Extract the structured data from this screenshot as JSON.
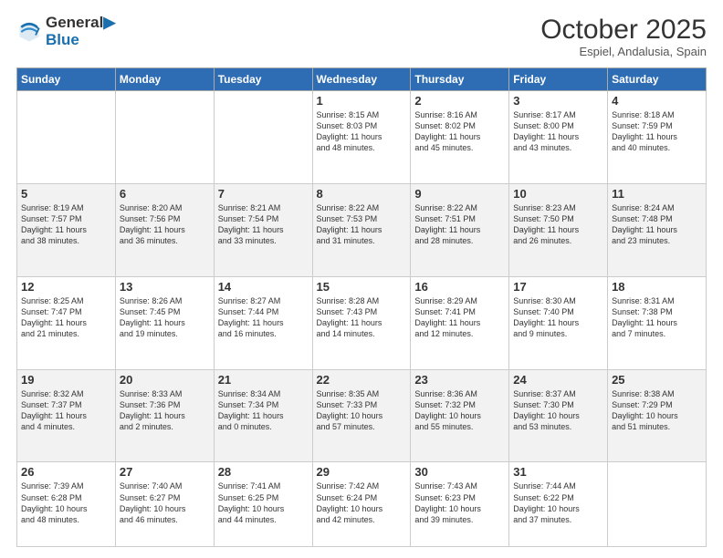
{
  "logo": {
    "line1": "General",
    "line2": "Blue"
  },
  "title": "October 2025",
  "subtitle": "Espiel, Andalusia, Spain",
  "days": [
    "Sunday",
    "Monday",
    "Tuesday",
    "Wednesday",
    "Thursday",
    "Friday",
    "Saturday"
  ],
  "weeks": [
    [
      {
        "day": "",
        "text": ""
      },
      {
        "day": "",
        "text": ""
      },
      {
        "day": "",
        "text": ""
      },
      {
        "day": "1",
        "text": "Sunrise: 8:15 AM\nSunset: 8:03 PM\nDaylight: 11 hours\nand 48 minutes."
      },
      {
        "day": "2",
        "text": "Sunrise: 8:16 AM\nSunset: 8:02 PM\nDaylight: 11 hours\nand 45 minutes."
      },
      {
        "day": "3",
        "text": "Sunrise: 8:17 AM\nSunset: 8:00 PM\nDaylight: 11 hours\nand 43 minutes."
      },
      {
        "day": "4",
        "text": "Sunrise: 8:18 AM\nSunset: 7:59 PM\nDaylight: 11 hours\nand 40 minutes."
      }
    ],
    [
      {
        "day": "5",
        "text": "Sunrise: 8:19 AM\nSunset: 7:57 PM\nDaylight: 11 hours\nand 38 minutes."
      },
      {
        "day": "6",
        "text": "Sunrise: 8:20 AM\nSunset: 7:56 PM\nDaylight: 11 hours\nand 36 minutes."
      },
      {
        "day": "7",
        "text": "Sunrise: 8:21 AM\nSunset: 7:54 PM\nDaylight: 11 hours\nand 33 minutes."
      },
      {
        "day": "8",
        "text": "Sunrise: 8:22 AM\nSunset: 7:53 PM\nDaylight: 11 hours\nand 31 minutes."
      },
      {
        "day": "9",
        "text": "Sunrise: 8:22 AM\nSunset: 7:51 PM\nDaylight: 11 hours\nand 28 minutes."
      },
      {
        "day": "10",
        "text": "Sunrise: 8:23 AM\nSunset: 7:50 PM\nDaylight: 11 hours\nand 26 minutes."
      },
      {
        "day": "11",
        "text": "Sunrise: 8:24 AM\nSunset: 7:48 PM\nDaylight: 11 hours\nand 23 minutes."
      }
    ],
    [
      {
        "day": "12",
        "text": "Sunrise: 8:25 AM\nSunset: 7:47 PM\nDaylight: 11 hours\nand 21 minutes."
      },
      {
        "day": "13",
        "text": "Sunrise: 8:26 AM\nSunset: 7:45 PM\nDaylight: 11 hours\nand 19 minutes."
      },
      {
        "day": "14",
        "text": "Sunrise: 8:27 AM\nSunset: 7:44 PM\nDaylight: 11 hours\nand 16 minutes."
      },
      {
        "day": "15",
        "text": "Sunrise: 8:28 AM\nSunset: 7:43 PM\nDaylight: 11 hours\nand 14 minutes."
      },
      {
        "day": "16",
        "text": "Sunrise: 8:29 AM\nSunset: 7:41 PM\nDaylight: 11 hours\nand 12 minutes."
      },
      {
        "day": "17",
        "text": "Sunrise: 8:30 AM\nSunset: 7:40 PM\nDaylight: 11 hours\nand 9 minutes."
      },
      {
        "day": "18",
        "text": "Sunrise: 8:31 AM\nSunset: 7:38 PM\nDaylight: 11 hours\nand 7 minutes."
      }
    ],
    [
      {
        "day": "19",
        "text": "Sunrise: 8:32 AM\nSunset: 7:37 PM\nDaylight: 11 hours\nand 4 minutes."
      },
      {
        "day": "20",
        "text": "Sunrise: 8:33 AM\nSunset: 7:36 PM\nDaylight: 11 hours\nand 2 minutes."
      },
      {
        "day": "21",
        "text": "Sunrise: 8:34 AM\nSunset: 7:34 PM\nDaylight: 11 hours\nand 0 minutes."
      },
      {
        "day": "22",
        "text": "Sunrise: 8:35 AM\nSunset: 7:33 PM\nDaylight: 10 hours\nand 57 minutes."
      },
      {
        "day": "23",
        "text": "Sunrise: 8:36 AM\nSunset: 7:32 PM\nDaylight: 10 hours\nand 55 minutes."
      },
      {
        "day": "24",
        "text": "Sunrise: 8:37 AM\nSunset: 7:30 PM\nDaylight: 10 hours\nand 53 minutes."
      },
      {
        "day": "25",
        "text": "Sunrise: 8:38 AM\nSunset: 7:29 PM\nDaylight: 10 hours\nand 51 minutes."
      }
    ],
    [
      {
        "day": "26",
        "text": "Sunrise: 7:39 AM\nSunset: 6:28 PM\nDaylight: 10 hours\nand 48 minutes."
      },
      {
        "day": "27",
        "text": "Sunrise: 7:40 AM\nSunset: 6:27 PM\nDaylight: 10 hours\nand 46 minutes."
      },
      {
        "day": "28",
        "text": "Sunrise: 7:41 AM\nSunset: 6:25 PM\nDaylight: 10 hours\nand 44 minutes."
      },
      {
        "day": "29",
        "text": "Sunrise: 7:42 AM\nSunset: 6:24 PM\nDaylight: 10 hours\nand 42 minutes."
      },
      {
        "day": "30",
        "text": "Sunrise: 7:43 AM\nSunset: 6:23 PM\nDaylight: 10 hours\nand 39 minutes."
      },
      {
        "day": "31",
        "text": "Sunrise: 7:44 AM\nSunset: 6:22 PM\nDaylight: 10 hours\nand 37 minutes."
      },
      {
        "day": "",
        "text": ""
      }
    ]
  ]
}
